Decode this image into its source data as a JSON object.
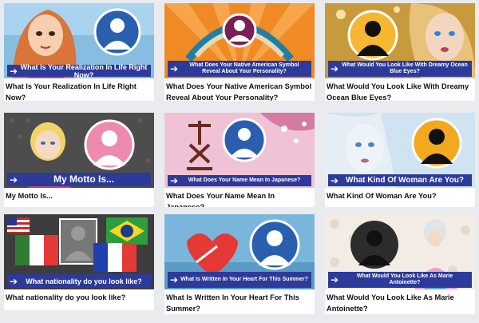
{
  "quizzes": [
    {
      "banner": "What Is Your Realization In Life Right Now?",
      "title": "What Is Your Realization In Life Right Now?",
      "colors": {
        "bg": "#7fb3d9",
        "accent": "#f2c9a7"
      }
    },
    {
      "banner": "What Does Your Native American Symbol Reveal About Your Personality?",
      "title": "What Does Your Native American Symbol Reveal About Your Personality?",
      "colors": {
        "bg": "#f07a1a",
        "accent": "#2a8fb0"
      }
    },
    {
      "banner": "What Would You Look Like With Dreamy Ocean Blue Eyes?",
      "title": "What Would You Look Like With Dreamy Ocean Blue Eyes?",
      "colors": {
        "bg": "#c9a24a",
        "accent": "#2c2c2c"
      }
    },
    {
      "banner": "My Motto Is...",
      "title": "My Motto Is...",
      "colors": {
        "bg": "#4a4a4a",
        "accent": "#ee8ab0"
      }
    },
    {
      "banner": "What Does Your Name Mean In Japanese?",
      "title": "What Does Your Name Mean In Japanese?",
      "colors": {
        "bg": "#e8a9c4",
        "accent": "#6a2a1e"
      }
    },
    {
      "banner": "What Kind Of Woman Are You?",
      "title": "What Kind Of Woman Are You?",
      "colors": {
        "bg": "#b9d6ea",
        "accent": "#f0a818"
      }
    },
    {
      "banner": "What nationality do you look like?",
      "title": "What nationality do you look like?",
      "colors": {
        "bg": "#3a3a3a",
        "accent": "#e53935"
      }
    },
    {
      "banner": "What Is Written In Your Heart For This Summer?",
      "title": "What Is Written In Your Heart For This Summer?",
      "colors": {
        "bg": "#6ab0d8",
        "accent": "#e53935"
      }
    },
    {
      "banner": "What Would You Look Like As Marie Antoinette?",
      "title": "What Would You Look Like As Marie Antoinette?",
      "colors": {
        "bg": "#f0ebe3",
        "accent": "#2c2c2c"
      }
    }
  ],
  "icons": {
    "arrow": "right-arrow-icon",
    "silhouette": "person-silhouette-icon"
  }
}
